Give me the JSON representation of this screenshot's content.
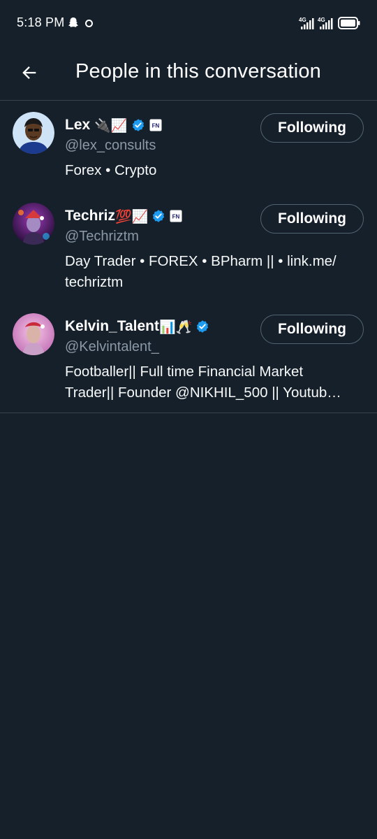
{
  "status_bar": {
    "time": "5:18 PM",
    "network_1": "4G",
    "network_2": "4G",
    "icons": [
      "snapchat-ghost-icon",
      "circle-dot-icon",
      "signal-icon",
      "signal-icon",
      "battery-icon"
    ]
  },
  "header": {
    "title": "People in this conversation",
    "back_icon": "arrow-left-icon"
  },
  "users": [
    {
      "name": "Lex",
      "name_emoji": "🔌📈",
      "handle": "@lex_consults",
      "bio_lines": [
        "Forex • Crypto"
      ],
      "verified": true,
      "affiliate_badge": "FN",
      "follow_label": "Following"
    },
    {
      "name": "Techriz",
      "name_emoji": "💯📈",
      "handle": "@Techriztm",
      "bio_lines": [
        "Day Trader • FOREX • BPharm || • link.me/",
        "techriztm"
      ],
      "verified": true,
      "affiliate_badge": "FN",
      "follow_label": "Following"
    },
    {
      "name": "Kelvin_Talent",
      "name_emoji": "📊🥂",
      "handle": "@Kelvintalent_",
      "bio_lines": [
        "Footballer|| Full time Financial Market",
        "Trader|| Founder @NIKHIL_500 || Youtub…"
      ],
      "verified": true,
      "affiliate_badge": "",
      "follow_label": "Following"
    }
  ],
  "colors": {
    "background": "#15202b",
    "divider": "#38444d",
    "handle": "#8b98a5",
    "verified": "#1d9bf0",
    "button_border": "#536471"
  }
}
